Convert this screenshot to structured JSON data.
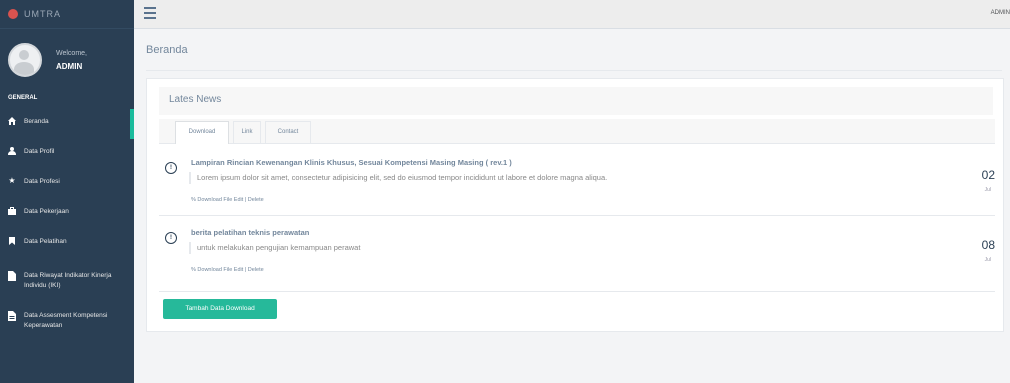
{
  "brand": {
    "title": "UMTRA"
  },
  "profile": {
    "welcome": "Welcome,",
    "name": "ADMIN"
  },
  "section_label": "GENERAL",
  "sidebar": {
    "items": [
      {
        "label": "Beranda",
        "icon": "home-icon"
      },
      {
        "label": "Data Profil",
        "icon": "user-icon"
      },
      {
        "label": "Data Profesi",
        "icon": "star-icon"
      },
      {
        "label": "Data Pekerjaan",
        "icon": "briefcase-icon"
      },
      {
        "label": "Data Pelatihan",
        "icon": "bookmark-icon"
      },
      {
        "label": "Data Riwayat Indikator Kinerja Individu (IKI)",
        "icon": "file-icon"
      },
      {
        "label": "Data Assesment Kompetensi Keperawatan",
        "icon": "file-text-icon"
      }
    ]
  },
  "topbar": {
    "user": "ADMIN"
  },
  "breadcrumb": "Beranda",
  "panel": {
    "title": "Lates News"
  },
  "tabs": [
    {
      "label": "Download"
    },
    {
      "label": "Link"
    },
    {
      "label": "Contact"
    }
  ],
  "news": [
    {
      "title": "Lampiran Rincian Kewenangan Klinis Khusus, Sesuai Kompetensi Masing Masing ( rev.1 )",
      "description": "Lorem ipsum dolor sit amet, consectetur adipisicing elit, sed do eiusmod tempor incididunt ut labore et dolore magna aliqua.",
      "links": "% Download File Edit | Delete",
      "day": "02",
      "month": "Jul"
    },
    {
      "title": "berita pelatihan teknis perawatan",
      "description": "untuk melakukan pengujian kemampuan perawat",
      "links": "% Download File Edit | Delete",
      "day": "08",
      "month": "Jul"
    }
  ],
  "add_button": "Tambah Data Download",
  "colors": {
    "sidebar": "#2a3f54",
    "accent": "#26b99a",
    "active_marker": "#1abb9c"
  }
}
